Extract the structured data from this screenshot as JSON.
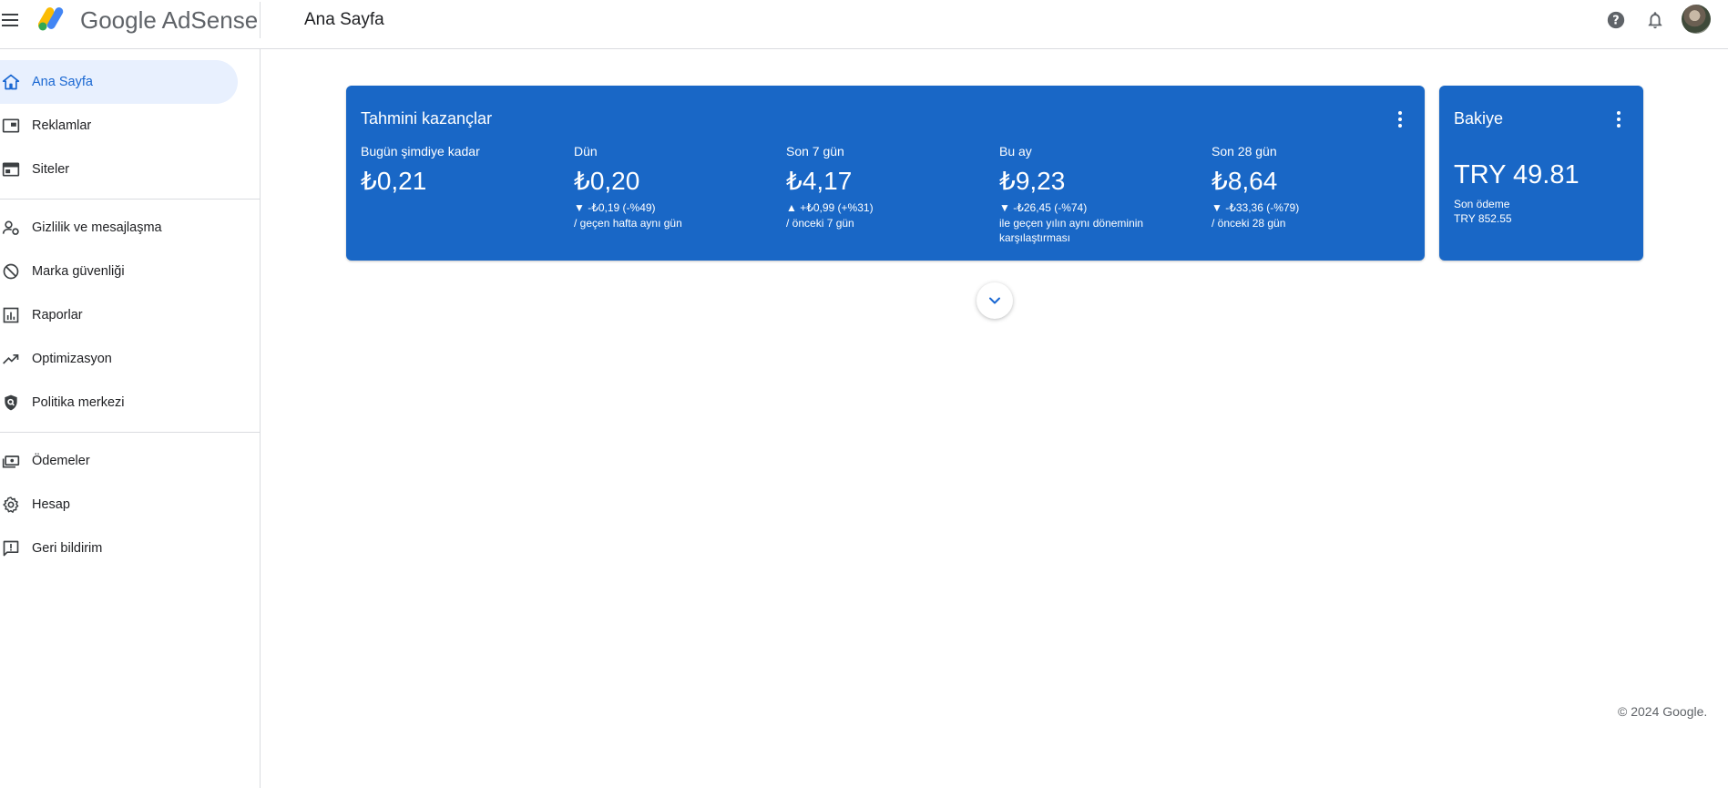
{
  "header": {
    "brand": "Google AdSense",
    "page_title": "Ana Sayfa",
    "icons": {
      "menu": "menu-icon",
      "help": "help-icon",
      "notifications": "bell-icon",
      "avatar": "avatar"
    }
  },
  "sidebar": {
    "items": [
      {
        "label": "Ana Sayfa",
        "icon": "home-icon",
        "active": true
      },
      {
        "label": "Reklamlar",
        "icon": "ads-icon"
      },
      {
        "label": "Siteler",
        "icon": "sites-icon"
      },
      {
        "label": "Gizlilik ve mesajlaşma",
        "icon": "privacy-icon"
      },
      {
        "label": "Marka güvenliği",
        "icon": "block-icon"
      },
      {
        "label": "Raporlar",
        "icon": "reports-icon"
      },
      {
        "label": "Optimizasyon",
        "icon": "trending-icon"
      },
      {
        "label": "Politika merkezi",
        "icon": "policy-icon"
      },
      {
        "label": "Ödemeler",
        "icon": "payments-icon"
      },
      {
        "label": "Hesap",
        "icon": "gear-icon"
      },
      {
        "label": "Geri bildirim",
        "icon": "feedback-icon"
      }
    ]
  },
  "earnings": {
    "title": "Tahmini kazançlar",
    "metrics": [
      {
        "label": "Bugün şimdiye kadar",
        "value": "₺0,21",
        "change": "",
        "compare": ""
      },
      {
        "label": "Dün",
        "value": "₺0,20",
        "change": "▼ -₺0,19 (-%49)",
        "compare": "/ geçen hafta aynı gün"
      },
      {
        "label": "Son 7 gün",
        "value": "₺4,17",
        "change": "▲ +₺0,99 (+%31)",
        "compare": "/ önceki 7 gün"
      },
      {
        "label": "Bu ay",
        "value": "₺9,23",
        "change": "▼ -₺26,45 (-%74)",
        "compare": "ile geçen yılın aynı döneminin karşılaştırması"
      },
      {
        "label": "Son 28 gün",
        "value": "₺8,64",
        "change": "▼ -₺33,36 (-%79)",
        "compare": "/ önceki 28 gün"
      }
    ]
  },
  "balance": {
    "title": "Bakiye",
    "value": "TRY 49.81",
    "last_payment_label": "Son ödeme",
    "last_payment_amount": "TRY 852.55"
  },
  "expand_icon": "chevron-down-icon",
  "footer": "© 2024 Google.",
  "colors": {
    "card": "#1967c6",
    "active_nav_bg": "#e8f0fe",
    "active_nav_text": "#1967d2"
  }
}
